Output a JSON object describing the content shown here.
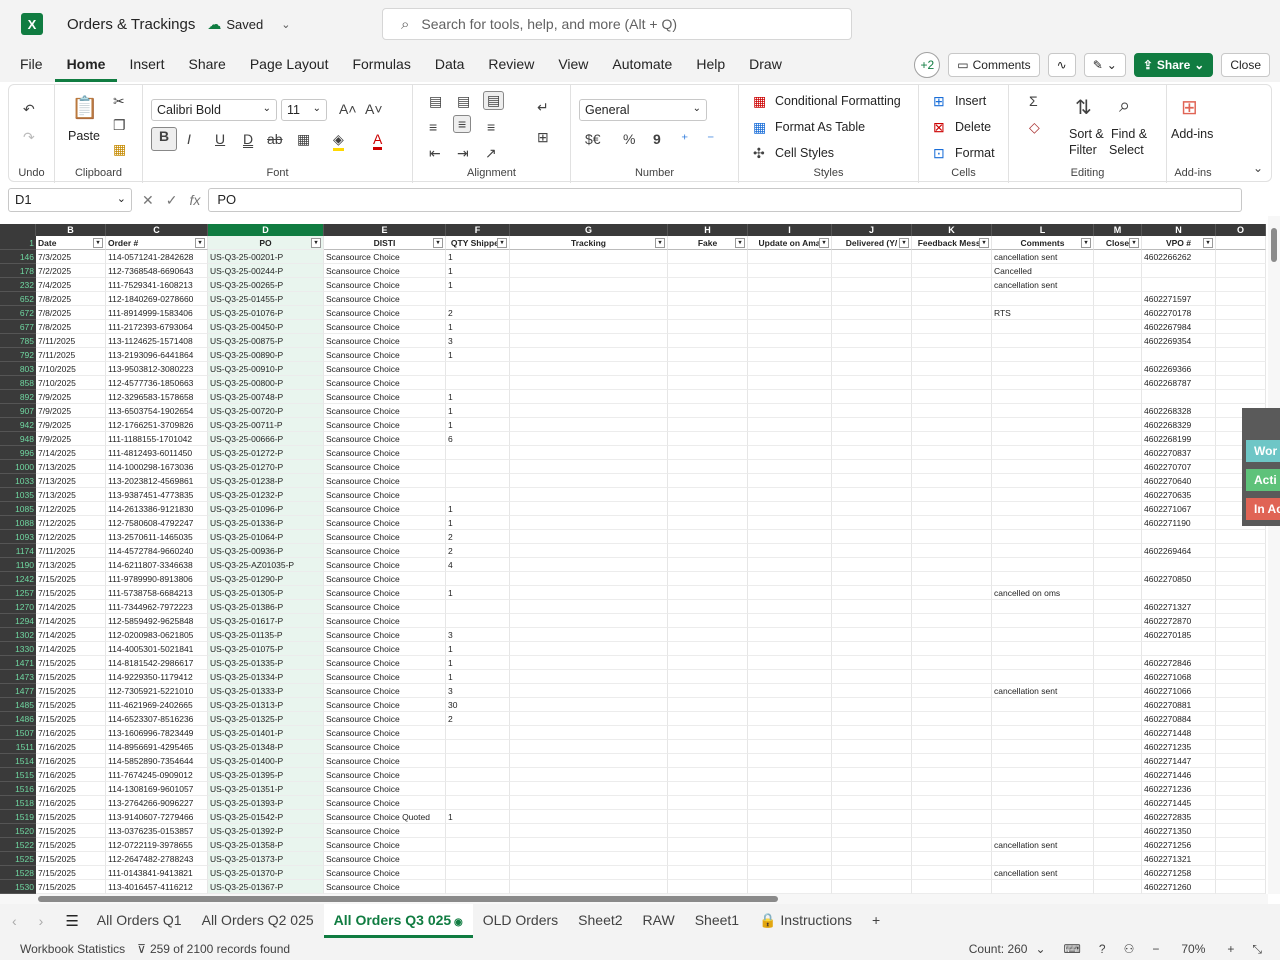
{
  "app": {
    "logo": "X",
    "title": "Orders & Trackings",
    "saved": "Saved",
    "search_placeholder": "Search for tools, help, and more (Alt + Q)"
  },
  "menu": {
    "tabs": [
      "File",
      "Home",
      "Insert",
      "Share",
      "Page Layout",
      "Formulas",
      "Data",
      "Review",
      "View",
      "Automate",
      "Help",
      "Draw"
    ],
    "active": "Home",
    "presence": "+2",
    "comments": "Comments",
    "share": "Share",
    "close": "Close"
  },
  "ribbon": {
    "undo": {
      "label": "Undo"
    },
    "clipboard": {
      "paste": "Paste",
      "label": "Clipboard"
    },
    "font": {
      "name": "Calibri Bold",
      "size": "11",
      "bold": "B",
      "italic": "I",
      "underline": "U",
      "dunder": "D",
      "strike": "ab",
      "label": "Font"
    },
    "alignment": {
      "label": "Alignment"
    },
    "number": {
      "format": "General",
      "currency": "$€",
      "percent": "%",
      "comma": "9",
      "label": "Number"
    },
    "styles": {
      "cond": "Conditional Formatting",
      "table": "Format As Table",
      "cell": "Cell Styles",
      "label": "Styles"
    },
    "cells": {
      "insert": "Insert",
      "delete": "Delete",
      "format": "Format",
      "label": "Cells"
    },
    "editing": {
      "sort1": "Sort &",
      "sort2": "Filter",
      "find1": "Find &",
      "find2": "Select",
      "sum": "Σ",
      "label": "Editing"
    },
    "addins": {
      "btn": "Add-ins",
      "label": "Add-ins"
    }
  },
  "formula_bar": {
    "name_box": "D1",
    "content": "PO",
    "fx": "fx"
  },
  "columns": [
    "B",
    "C",
    "D",
    "E",
    "F",
    "G",
    "H",
    "I",
    "J",
    "K",
    "L",
    "M",
    "N",
    "O"
  ],
  "first_row_number": "1",
  "headers": [
    "Date",
    "Order #",
    "PO",
    "DISTI",
    "QTY Shipped",
    "Tracking",
    "Fake",
    "Update on Ama",
    "Delivered (Y/",
    "Feedback Messa",
    "Comments",
    "Close",
    "VPO #",
    ""
  ],
  "rows": [
    [
      "146",
      "7/3/2025",
      "114-0571241-2842628",
      "US-Q3-25-00201-P",
      "Scansource Choice",
      "1",
      "",
      "",
      "",
      "",
      "",
      "cancellation sent",
      "",
      "4602266262"
    ],
    [
      "178",
      "7/2/2025",
      "112-7368548-6690643",
      "US-Q3-25-00244-P",
      "Scansource Choice",
      "1",
      "",
      "",
      "",
      "",
      "",
      "Cancelled",
      "",
      ""
    ],
    [
      "232",
      "7/4/2025",
      "111-7529341-1608213",
      "US-Q3-25-00265-P",
      "Scansource Choice",
      "1",
      "",
      "",
      "",
      "",
      "",
      "cancellation sent",
      "",
      ""
    ],
    [
      "652",
      "7/8/2025",
      "112-1840269-0278660",
      "US-Q3-25-01455-P",
      "Scansource Choice",
      "",
      "",
      "",
      "",
      "",
      "",
      "",
      "",
      "4602271597"
    ],
    [
      "672",
      "7/8/2025",
      "111-8914999-1583406",
      "US-Q3-25-01076-P",
      "Scansource Choice",
      "2",
      "",
      "",
      "",
      "",
      "",
      "RTS",
      "",
      "4602270178"
    ],
    [
      "677",
      "7/8/2025",
      "111-2172393-6793064",
      "US-Q3-25-00450-P",
      "Scansource Choice",
      "1",
      "",
      "",
      "",
      "",
      "",
      "",
      "",
      "4602267984"
    ],
    [
      "785",
      "7/11/2025",
      "113-1124625-1571408",
      "US-Q3-25-00875-P",
      "Scansource Choice",
      "3",
      "",
      "",
      "",
      "",
      "",
      "",
      "",
      "4602269354"
    ],
    [
      "792",
      "7/11/2025",
      "113-2193096-6441864",
      "US-Q3-25-00890-P",
      "Scansource Choice",
      "1",
      "",
      "",
      "",
      "",
      "",
      "",
      "",
      ""
    ],
    [
      "803",
      "7/10/2025",
      "113-9503812-3080223",
      "US-Q3-25-00910-P",
      "Scansource Choice",
      "",
      "",
      "",
      "",
      "",
      "",
      "",
      "",
      "4602269366"
    ],
    [
      "858",
      "7/10/2025",
      "112-4577736-1850663",
      "US-Q3-25-00800-P",
      "Scansource Choice",
      "",
      "",
      "",
      "",
      "",
      "",
      "",
      "",
      "4602268787"
    ],
    [
      "892",
      "7/9/2025",
      "112-3296583-1578658",
      "US-Q3-25-00748-P",
      "Scansource Choice",
      "1",
      "",
      "",
      "",
      "",
      "",
      "",
      "",
      ""
    ],
    [
      "907",
      "7/9/2025",
      "113-6503754-1902654",
      "US-Q3-25-00720-P",
      "Scansource Choice",
      "1",
      "",
      "",
      "",
      "",
      "",
      "",
      "",
      "4602268328"
    ],
    [
      "942",
      "7/9/2025",
      "112-1766251-3709826",
      "US-Q3-25-00711-P",
      "Scansource Choice",
      "1",
      "",
      "",
      "",
      "",
      "",
      "",
      "",
      "4602268329"
    ],
    [
      "948",
      "7/9/2025",
      "111-1188155-1701042",
      "US-Q3-25-00666-P",
      "Scansource Choice",
      "6",
      "",
      "",
      "",
      "",
      "",
      "",
      "",
      "4602268199"
    ],
    [
      "996",
      "7/14/2025",
      "111-4812493-6011450",
      "US-Q3-25-01272-P",
      "Scansource Choice",
      "",
      "",
      "",
      "",
      "",
      "",
      "",
      "",
      "4602270837"
    ],
    [
      "1000",
      "7/13/2025",
      "114-1000298-1673036",
      "US-Q3-25-01270-P",
      "Scansource Choice",
      "",
      "",
      "",
      "",
      "",
      "",
      "",
      "",
      "4602270707"
    ],
    [
      "1033",
      "7/13/2025",
      "113-2023812-4569861",
      "US-Q3-25-01238-P",
      "Scansource Choice",
      "",
      "",
      "",
      "",
      "",
      "",
      "",
      "",
      "4602270640"
    ],
    [
      "1035",
      "7/13/2025",
      "113-9387451-4773835",
      "US-Q3-25-01232-P",
      "Scansource Choice",
      "",
      "",
      "",
      "",
      "",
      "",
      "",
      "",
      "4602270635"
    ],
    [
      "1085",
      "7/12/2025",
      "114-2613386-9121830",
      "US-Q3-25-01096-P",
      "Scansource Choice",
      "1",
      "",
      "",
      "",
      "",
      "",
      "",
      "",
      "4602271067"
    ],
    [
      "1088",
      "7/12/2025",
      "112-7580608-4792247",
      "US-Q3-25-01336-P",
      "Scansource Choice",
      "1",
      "",
      "",
      "",
      "",
      "",
      "",
      "",
      "4602271190"
    ],
    [
      "1093",
      "7/12/2025",
      "113-2570611-1465035",
      "US-Q3-25-01064-P",
      "Scansource Choice",
      "2",
      "",
      "",
      "",
      "",
      "",
      "",
      "",
      ""
    ],
    [
      "1174",
      "7/11/2025",
      "114-4572784-9660240",
      "US-Q3-25-00936-P",
      "Scansource Choice",
      "2",
      "",
      "",
      "",
      "",
      "",
      "",
      "",
      "4602269464"
    ],
    [
      "1190",
      "7/13/2025",
      "114-6211807-3346638",
      "US-Q3-25-AZ01035-P",
      "Scansource Choice",
      "4",
      "",
      "",
      "",
      "",
      "",
      "",
      "",
      ""
    ],
    [
      "1242",
      "7/15/2025",
      "111-9789990-8913806",
      "US-Q3-25-01290-P",
      "Scansource Choice",
      "",
      "",
      "",
      "",
      "",
      "",
      "",
      "",
      "4602270850"
    ],
    [
      "1257",
      "7/15/2025",
      "111-5738758-6684213",
      "US-Q3-25-01305-P",
      "Scansource Choice",
      "1",
      "",
      "",
      "",
      "",
      "",
      "cancelled on oms",
      "",
      ""
    ],
    [
      "1270",
      "7/14/2025",
      "111-7344962-7972223",
      "US-Q3-25-01386-P",
      "Scansource Choice",
      "",
      "",
      "",
      "",
      "",
      "",
      "",
      "",
      "4602271327"
    ],
    [
      "1294",
      "7/14/2025",
      "112-5859492-9625848",
      "US-Q3-25-01617-P",
      "Scansource Choice",
      "",
      "",
      "",
      "",
      "",
      "",
      "",
      "",
      "4602272870"
    ],
    [
      "1302",
      "7/14/2025",
      "112-0200983-0621805",
      "US-Q3-25-01135-P",
      "Scansource Choice",
      "3",
      "",
      "",
      "",
      "",
      "",
      "",
      "",
      "4602270185"
    ],
    [
      "1330",
      "7/14/2025",
      "114-4005301-5021841",
      "US-Q3-25-01075-P",
      "Scansource Choice",
      "1",
      "",
      "",
      "",
      "",
      "",
      "",
      "",
      ""
    ],
    [
      "1471",
      "7/15/2025",
      "114-8181542-2986617",
      "US-Q3-25-01335-P",
      "Scansource Choice",
      "1",
      "",
      "",
      "",
      "",
      "",
      "",
      "",
      "4602272846"
    ],
    [
      "1473",
      "7/15/2025",
      "114-9229350-1179412",
      "US-Q3-25-01334-P",
      "Scansource Choice",
      "1",
      "",
      "",
      "",
      "",
      "",
      "",
      "",
      "4602271068"
    ],
    [
      "1477",
      "7/15/2025",
      "112-7305921-5221010",
      "US-Q3-25-01333-P",
      "Scansource Choice",
      "3",
      "",
      "",
      "",
      "",
      "",
      "cancellation sent",
      "",
      "4602271066"
    ],
    [
      "1485",
      "7/15/2025",
      "111-4621969-2402665",
      "US-Q3-25-01313-P",
      "Scansource Choice",
      "30",
      "",
      "",
      "",
      "",
      "",
      "",
      "",
      "4602270881"
    ],
    [
      "1486",
      "7/15/2025",
      "114-6523307-8516236",
      "US-Q3-25-01325-P",
      "Scansource Choice",
      "2",
      "",
      "",
      "",
      "",
      "",
      "",
      "",
      "4602270884"
    ],
    [
      "1507",
      "7/16/2025",
      "113-1606996-7823449",
      "US-Q3-25-01401-P",
      "Scansource Choice",
      "",
      "",
      "",
      "",
      "",
      "",
      "",
      "",
      "4602271448"
    ],
    [
      "1511",
      "7/16/2025",
      "114-8956691-4295465",
      "US-Q3-25-01348-P",
      "Scansource Choice",
      "",
      "",
      "",
      "",
      "",
      "",
      "",
      "",
      "4602271235"
    ],
    [
      "1514",
      "7/16/2025",
      "114-5852890-7354644",
      "US-Q3-25-01400-P",
      "Scansource Choice",
      "",
      "",
      "",
      "",
      "",
      "",
      "",
      "",
      "4602271447"
    ],
    [
      "1515",
      "7/16/2025",
      "111-7674245-0909012",
      "US-Q3-25-01395-P",
      "Scansource Choice",
      "",
      "",
      "",
      "",
      "",
      "",
      "",
      "",
      "4602271446"
    ],
    [
      "1516",
      "7/16/2025",
      "114-1308169-9601057",
      "US-Q3-25-01351-P",
      "Scansource Choice",
      "",
      "",
      "",
      "",
      "",
      "",
      "",
      "",
      "4602271236"
    ],
    [
      "1518",
      "7/16/2025",
      "113-2764266-9096227",
      "US-Q3-25-01393-P",
      "Scansource Choice",
      "",
      "",
      "",
      "",
      "",
      "",
      "",
      "",
      "4602271445"
    ],
    [
      "1519",
      "7/15/2025",
      "113-9140607-7279466",
      "US-Q3-25-01542-P",
      "Scansource Choice Quoted",
      "1",
      "",
      "",
      "",
      "",
      "",
      "",
      "",
      "4602272835"
    ],
    [
      "1520",
      "7/15/2025",
      "113-0376235-0153857",
      "US-Q3-25-01392-P",
      "Scansource Choice",
      "",
      "",
      "",
      "",
      "",
      "",
      "",
      "",
      "4602271350"
    ],
    [
      "1522",
      "7/15/2025",
      "112-0722119-3978655",
      "US-Q3-25-01358-P",
      "Scansource Choice",
      "",
      "",
      "",
      "",
      "",
      "",
      "cancellation sent",
      "",
      "4602271256"
    ],
    [
      "1525",
      "7/15/2025",
      "112-2647482-2788243",
      "US-Q3-25-01373-P",
      "Scansource Choice",
      "",
      "",
      "",
      "",
      "",
      "",
      "",
      "",
      "4602271321"
    ],
    [
      "1528",
      "7/15/2025",
      "111-0143841-9413821",
      "US-Q3-25-01370-P",
      "Scansource Choice",
      "",
      "",
      "",
      "",
      "",
      "",
      "cancellation sent",
      "",
      "4602271258"
    ],
    [
      "1530",
      "7/15/2025",
      "113-4016457-4116212",
      "US-Q3-25-01367-P",
      "Scansource Choice",
      "",
      "",
      "",
      "",
      "",
      "",
      "",
      "",
      "4602271260"
    ]
  ],
  "side_panel": {
    "items": [
      {
        "label": "Wor",
        "color": "#6ec6c6"
      },
      {
        "label": "Acti",
        "color": "#5ec27a"
      },
      {
        "label": "In Ac",
        "color": "#e06455"
      }
    ]
  },
  "sheets": [
    "All Orders Q1",
    "All Orders Q2 025",
    "All Orders Q3 025",
    "OLD Orders",
    "Sheet2",
    "RAW",
    "Sheet1",
    "Instructions"
  ],
  "active_sheet": "All Orders Q3 025",
  "status": {
    "workbook_stats": "Workbook Statistics",
    "records": "259 of 2100 records found",
    "count": "Count: 260",
    "zoom": "70%"
  },
  "colors": {
    "accent": "#107c41",
    "header_dark": "#3a3a3a",
    "selected_col": "#e9f5ee"
  }
}
